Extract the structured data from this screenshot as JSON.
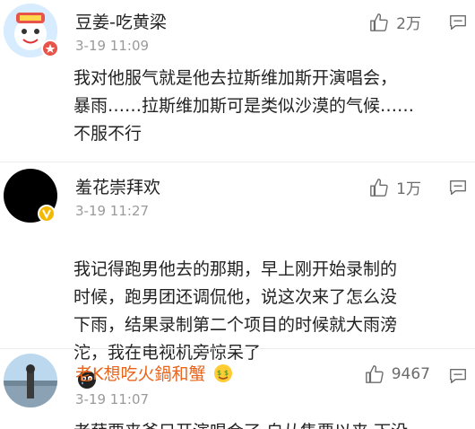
{
  "comments": [
    {
      "name": "豆姜-吃黄梁",
      "time": "3-19 11:09",
      "likes": "2万",
      "text": "我对他服气就是他去拉斯维加斯开演唱会，\n暴雨……拉斯维加斯可是类似沙漠的气候……\n不服不行",
      "badge_color": "#e8534a"
    },
    {
      "name": "羞花崇拜欢",
      "time": "3-19 11:27",
      "likes": "1万",
      "text": "我记得跑男他去的那期，早上刚开始录制的\n时候，跑男团还调侃他，说这次来了怎么没\n下雨，结果录制第二个项目的时候就大雨滂\n沱，我在电视机旁惊呆了",
      "badge_color": "#f5b800"
    },
    {
      "name": "老K想吃火鍋和蟹",
      "time": "3-19 11:07",
      "likes": "9467",
      "text": "老薛要来爷只开演唱会了 自从售票以来 下没",
      "name_color": "#e8641b"
    }
  ],
  "icons": {
    "like": "thumbs-up-icon",
    "reply": "comment-icon",
    "emoji_cry": "crying-face-icon",
    "emoji_rich": "money-eyes-icon"
  }
}
